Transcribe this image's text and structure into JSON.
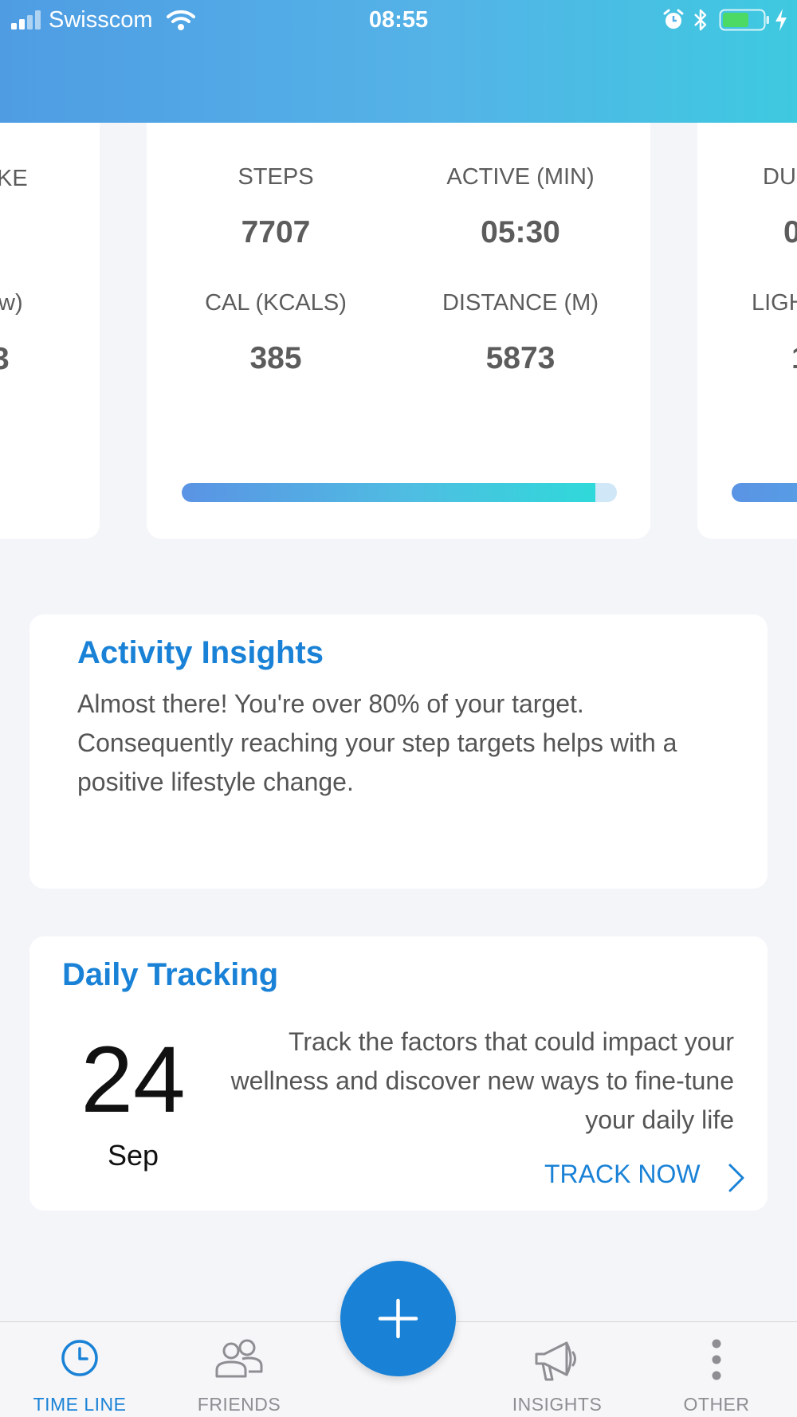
{
  "status_bar": {
    "carrier": "Swisscom",
    "time": "08:55",
    "battery_level": 0.65
  },
  "activity_cards": {
    "left_peek": {
      "label_top": "KE",
      "label_bottom": "w)",
      "value_bottom": "3"
    },
    "current": {
      "stats": [
        {
          "label": "STEPS",
          "value": "7707"
        },
        {
          "label": "ACTIVE (MIN)",
          "value": "05:30"
        },
        {
          "label": "CAL (KCALS)",
          "value": "385"
        },
        {
          "label": "DISTANCE (M)",
          "value": "5873"
        }
      ],
      "progress_fraction": 0.95
    },
    "right_peek": {
      "label_top": "DU",
      "value_top": "0",
      "label_bottom": "LIGH",
      "value_bottom": "1"
    }
  },
  "activity_insights": {
    "title": "Activity Insights",
    "body": "Almost there! You're over 80% of your target. Consequently reaching your step targets helps with a positive lifestyle change."
  },
  "daily_tracking": {
    "title": "Daily Tracking",
    "day": "24",
    "month": "Sep",
    "description": "Track the factors that could impact your wellness and discover new ways to fine-tune your daily life",
    "cta_label": "TRACK NOW"
  },
  "tab_bar": {
    "tabs": [
      {
        "label": "TIME LINE",
        "icon": "clock-icon",
        "active": true
      },
      {
        "label": "FRIENDS",
        "icon": "people-icon",
        "active": false
      },
      {
        "label": "INSIGHTS",
        "icon": "megaphone-icon",
        "active": false
      },
      {
        "label": "OTHER",
        "icon": "more-vertical-icon",
        "active": false
      }
    ],
    "fab_icon": "plus-icon"
  },
  "colors": {
    "accent": "#1a82d6",
    "header_start": "#4f9ce3",
    "header_end": "#3ec9e0",
    "battery_fill": "#4cd964"
  }
}
